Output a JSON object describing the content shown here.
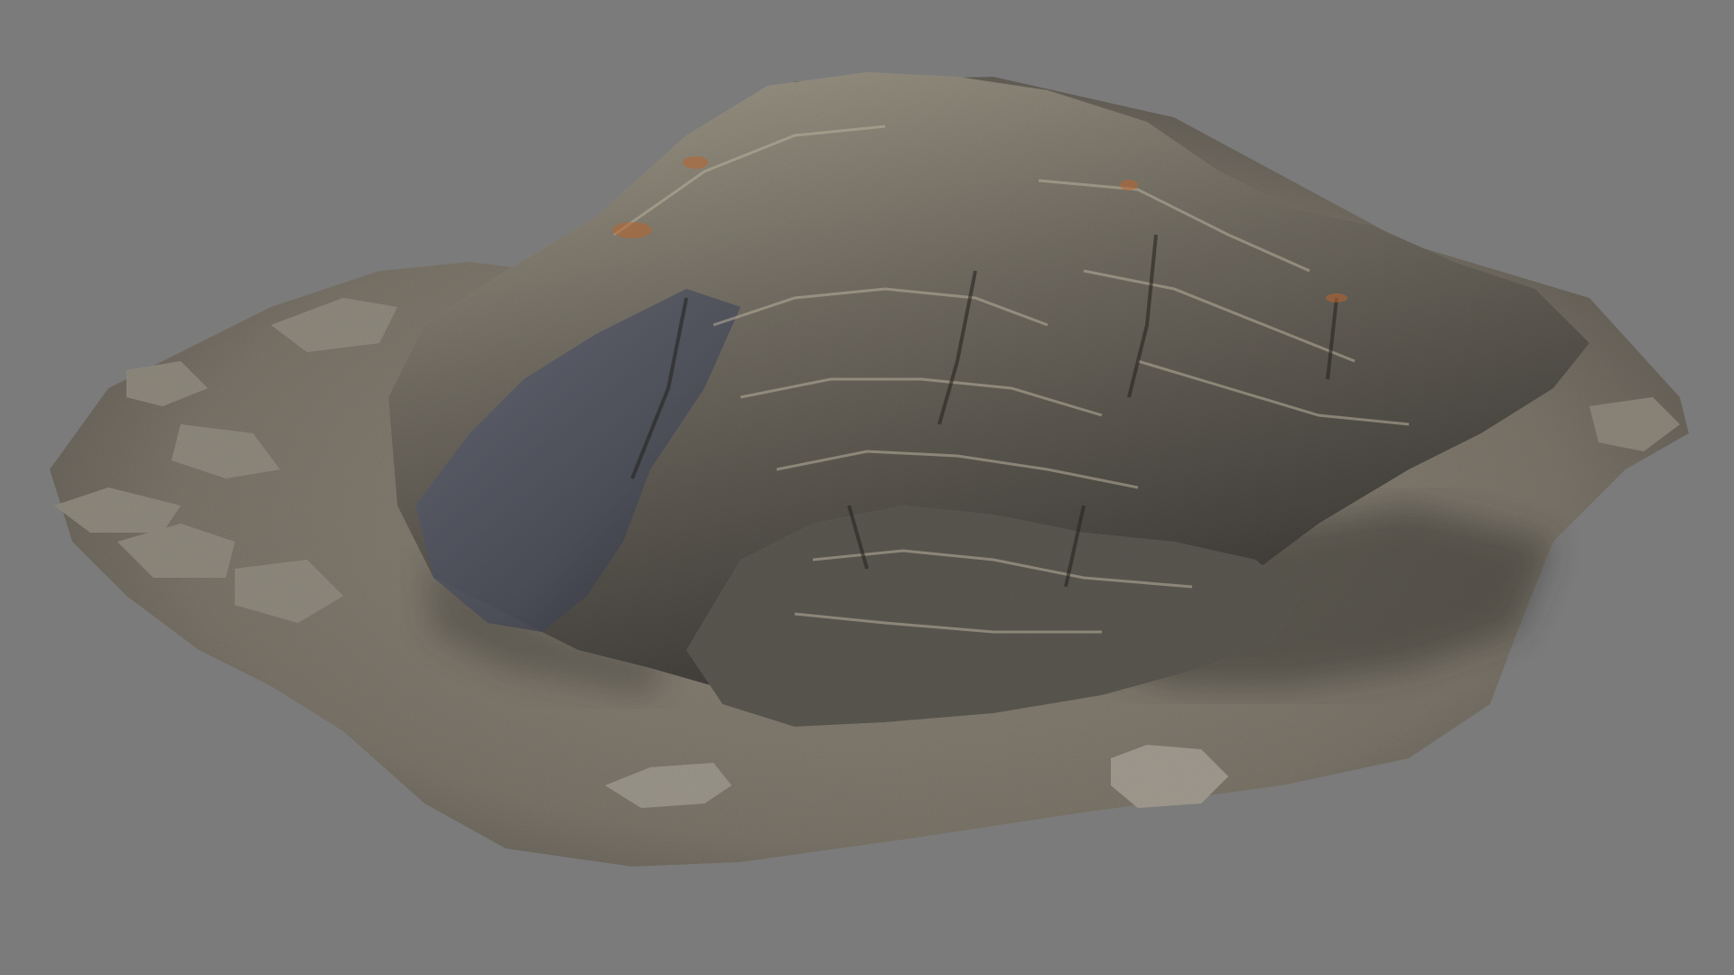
{
  "scene": {
    "subject": "rock-outcrop-scan",
    "background_color": "#7b7b7b",
    "palette": {
      "rock_light": "#9a9484",
      "rock_mid": "#6f6a60",
      "rock_dark": "#3f3c38",
      "rock_blue": "#4d5160",
      "rust": "#b8642e",
      "ground": "#8a8375",
      "ground_dark": "#5c574f",
      "shadow": "#2b2926"
    }
  }
}
